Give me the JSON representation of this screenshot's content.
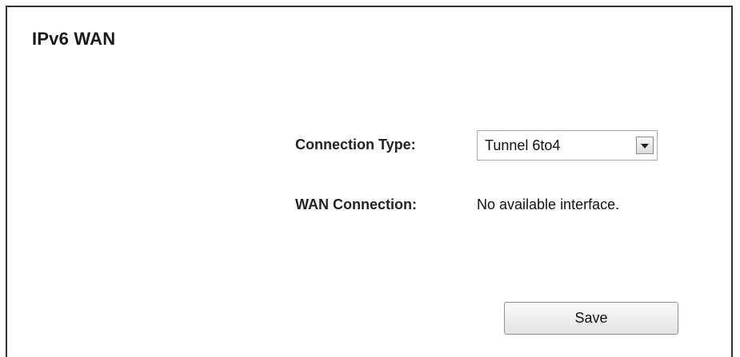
{
  "page": {
    "title": "IPv6 WAN"
  },
  "connection_type": {
    "label": "Connection Type:",
    "selected_value": "Tunnel 6to4"
  },
  "wan_connection": {
    "label": "WAN Connection:",
    "value": "No available interface."
  },
  "actions": {
    "save_label": "Save"
  },
  "icons": {
    "select_arrow": "chevron-down-icon"
  }
}
